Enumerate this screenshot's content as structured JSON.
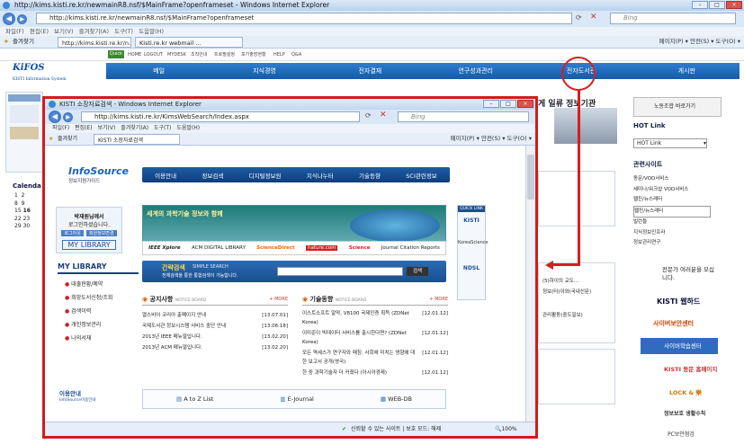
{
  "outer": {
    "title": "http://kims.kisti.re.kr/newmainR8.nsf/$MainFrame?openframeset - Windows Internet Explorer",
    "address": "http://kims.kisti.re.kr/newmainR8.nsf/$MainFrame?openframeset",
    "search_placeholder": "Bing",
    "menu": "파일(F)  편집(E)  보기(V)  즐겨찾기(A)  도구(T)  도움말(H)",
    "favorites_label": "즐겨찾기",
    "tabs": [
      "http://kims.kisti.re.kr/n...",
      "Kisti.re.kr webmail ..."
    ],
    "toolbar": "페이지(P) ▾  안전(S) ▾  도구(O) ▾",
    "top_links": [
      "HOME",
      "LOGOUT",
      "MYDESK",
      "조직안내",
      "프로필설정",
      "포가출장현황",
      "HELP",
      "Q&A"
    ],
    "quick_label": "Quick"
  },
  "kims": {
    "logo": "KiFOS",
    "logo_sub": "KISTI Information System",
    "nav": [
      "메일",
      "지식경영",
      "전자결재",
      "연구성과관리",
      "전자도서관",
      "게시판"
    ],
    "headline_fragment": "게 일류 정보기관",
    "right": {
      "banner1": "노동조합 바로가기",
      "hot_link_title": "HOT Link",
      "hot_link_select": "HOT Link",
      "related_title": "관련사이트",
      "related_items": [
        "동문/VOD서비스",
        "세미나/워크샵 VOD서비스",
        "웹진/뉴스레터",
        "웹진/뉴스레터",
        "빌런들",
        "지식정보인프라",
        "정보관리연구"
      ],
      "expert": "전문가 여러분을 모십니다.",
      "webhard": "KISTI 웹하드",
      "cyber": "사이버보안센터",
      "cyber2": "사이버학습센터",
      "alumni": "KISTI 동문 홈페이지",
      "lock": "LOCK & 樂",
      "info": "정보보호 생활수칙",
      "pc": "PC보안점검"
    },
    "mid_texts": [
      "(5)하이의 교도...",
      "정보(터)이와(국내신문)",
      "관리활동(중도일보)"
    ],
    "calendar_label": "Calenda",
    "calendar_days": [
      "1",
      "2",
      "8",
      "9",
      "15",
      "16",
      "22",
      "23",
      "29",
      "30"
    ]
  },
  "inner": {
    "title": "KISTI 소장자료검색 - Windows Internet Explorer",
    "address": "http://kims.kisti.re.kr/KimsWebSearch/Index.aspx",
    "search_placeholder": "Bing",
    "menu": "파일(F)  편집(E)  보기(V)  즐겨찾기(A)  도구(T)  도움말(H)",
    "favorites_label": "즐겨찾기",
    "tab": "KISTI 소장자료검색",
    "toolbar": "페이지(P) ▾  안전(S) ▾  도구(O) ▾",
    "status_site": "신뢰할 수 있는 사이트 | 보호 모드: 해제",
    "zoom": "100%"
  },
  "infosource": {
    "logo": "InfoSource",
    "logo_sub": "정보지원가이드",
    "nav": [
      "이용안내",
      "정보검색",
      "디지털정보원",
      "지식나누터",
      "기술동향",
      "SCI관련정보"
    ],
    "login_title": "박재원님께서",
    "login_sub": "로그인하셨습니다.",
    "login_btn1": "로그아웃",
    "login_btn2": "회원정보변경",
    "my_library_btn": "MY LIBRARY",
    "mylib_title": "MY LIBRARY",
    "mylib_items": [
      "대출현황/예약",
      "희망도서신청/조회",
      "검색이력",
      "개인정보관리",
      "나의서재"
    ],
    "banner_title": "세계의 과학기술 정보와 함께",
    "banner_logos": [
      "IEEE Xplore",
      "ACM DIGITAL LIBRARY",
      "ScienceDirect",
      "nature.com",
      "Science",
      "Journal Citation Reports"
    ],
    "simple_search_title": "간략검색",
    "simple_search_sub": "SIMPLE SEARCH",
    "simple_search_desc": "전체검색을 통한 통합검색이 가능합니다.",
    "search_btn": "검색",
    "notice_title": "공지사항",
    "notice_sub": "NOTICE BOARD",
    "notice_more": "+ MORE",
    "notices": [
      {
        "t": "열스비어 코리아 출폐이지 안내",
        "d": "[13.07.01]"
      },
      {
        "t": "국제도서관 정보시스템 서비스 중단 안내",
        "d": "[13.06.18]"
      },
      {
        "t": "2013년 IEEE 메뉴얼입니다.",
        "d": "[13.02.20]"
      },
      {
        "t": "2013년 ACM 메뉴얼입니다.",
        "d": "[13.02.20]"
      }
    ],
    "tech_title": "기술동향",
    "tech_sub": "NOTICE BOARD",
    "tech_more": "+ MORE",
    "techs": [
      {
        "t": "이스트소프트 알약, V8100 국제인증 획득 (ZDNet Korea)",
        "d": "[12.01.12]"
      },
      {
        "t": "이미준이 빅데이터 서비스를 출시한다면? (ZDNet Korea)",
        "d": "[12.01.12]"
      },
      {
        "t": "모든 역세스가 연구자와 매칭. 사회에 미치는 영향에 대한 보고서 공개(영국)",
        "d": "[12.01.12]"
      },
      {
        "t": "한 중 과학기술자 더 커졌다 (아시아경제)",
        "d": "[12.01.12]"
      }
    ],
    "bottom_links": [
      "A to Z List",
      "E-Journal",
      "WEB-DB"
    ],
    "guide": "이용안내",
    "guide_sub": "InfoSource이용안내",
    "quick_link": "QUICK LINK",
    "quick_items": [
      "KISTI",
      "KoreaScience",
      "NDSL"
    ]
  }
}
